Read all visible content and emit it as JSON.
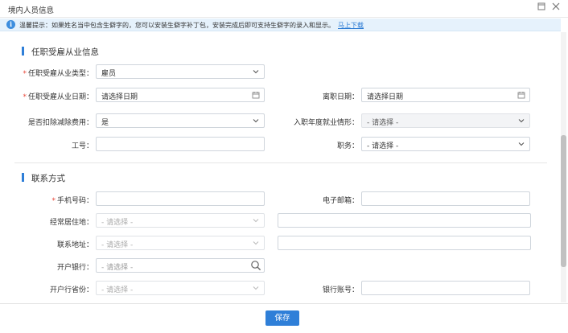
{
  "window": {
    "title": "境内人员信息",
    "restore_icon": "restore-icon",
    "close_icon": "close-icon"
  },
  "notice": {
    "icon": "info-icon",
    "text": "温馨提示：如果姓名当中包含生僻字的，您可以安装生僻字补丁包，安装完成后即可支持生僻字的录入和显示。",
    "link": "马上下载"
  },
  "employment_section": {
    "title": "任职受雇从业信息",
    "employment_type": {
      "label": "任职受雇从业类型：",
      "required": "*",
      "value": "雇员"
    },
    "employment_date": {
      "label": "任职受雇从业日期：",
      "required": "*",
      "placeholder": "请选择日期"
    },
    "leave_date": {
      "label": "离职日期：",
      "placeholder": "请选择日期"
    },
    "deduct_expense": {
      "label": "是否扣除减除费用：",
      "value": "是"
    },
    "entry_year_status": {
      "label": "入职年度就业情形：",
      "value": "- 请选择 -"
    },
    "employee_no": {
      "label": "工号：",
      "value": ""
    },
    "position": {
      "label": "职务：",
      "value": "- 请选择 -"
    }
  },
  "contact_section": {
    "title": "联系方式",
    "mobile": {
      "label": "手机号码：",
      "required": "*",
      "value": ""
    },
    "email": {
      "label": "电子邮箱：",
      "value": ""
    },
    "residence": {
      "label": "经常居住地：",
      "value": "- 请选择 -",
      "detail": ""
    },
    "contact_address": {
      "label": "联系地址：",
      "value": "- 请选择 -",
      "detail": ""
    },
    "bank": {
      "label": "开户银行：",
      "placeholder": "- 请选择 -"
    },
    "bank_province": {
      "label": "开户行省份：",
      "value": "- 请选择 -"
    },
    "bank_account": {
      "label": "银行账号：",
      "value": ""
    }
  },
  "footer": {
    "save_label": "保存"
  },
  "colors": {
    "primary": "#2f7fd8",
    "required": "#e8493a",
    "notice_bg": "#e6f2fc"
  }
}
